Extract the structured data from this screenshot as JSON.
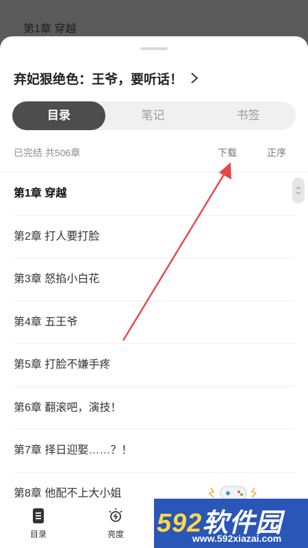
{
  "background": {
    "chapter_title": "第1章 穿越"
  },
  "sheet": {
    "book_title": "弃妃狠绝色：王爷，要听话！",
    "tabs": [
      {
        "label": "目录",
        "active": true
      },
      {
        "label": "笔记",
        "active": false
      },
      {
        "label": "书签",
        "active": false
      }
    ],
    "meta": {
      "status": "已完结 共506章",
      "download_label": "下载",
      "order_label": "正序"
    },
    "chapters": [
      {
        "label": "第1章 穿越",
        "current": true
      },
      {
        "label": "第2章 打人要打脸",
        "current": false
      },
      {
        "label": "第3章 怒掐小白花",
        "current": false
      },
      {
        "label": "第4章 五王爷",
        "current": false
      },
      {
        "label": "第5章 打脸不嫌手疼",
        "current": false
      },
      {
        "label": "第6章 翻滚吧，演技！",
        "current": false
      },
      {
        "label": "第7章 择日迎娶……？！",
        "current": false
      },
      {
        "label": "第8章 他配不上大小姐",
        "current": false
      }
    ]
  },
  "bottom_bar": {
    "items": [
      {
        "label": "目录",
        "icon": "catalog-icon"
      },
      {
        "label": "亮度",
        "icon": "brightness-icon"
      }
    ]
  },
  "watermark": {
    "brand_num": "592",
    "brand_text": "软件园",
    "url": "www.592xiazai.com"
  },
  "annotation_color": "#e8474a"
}
